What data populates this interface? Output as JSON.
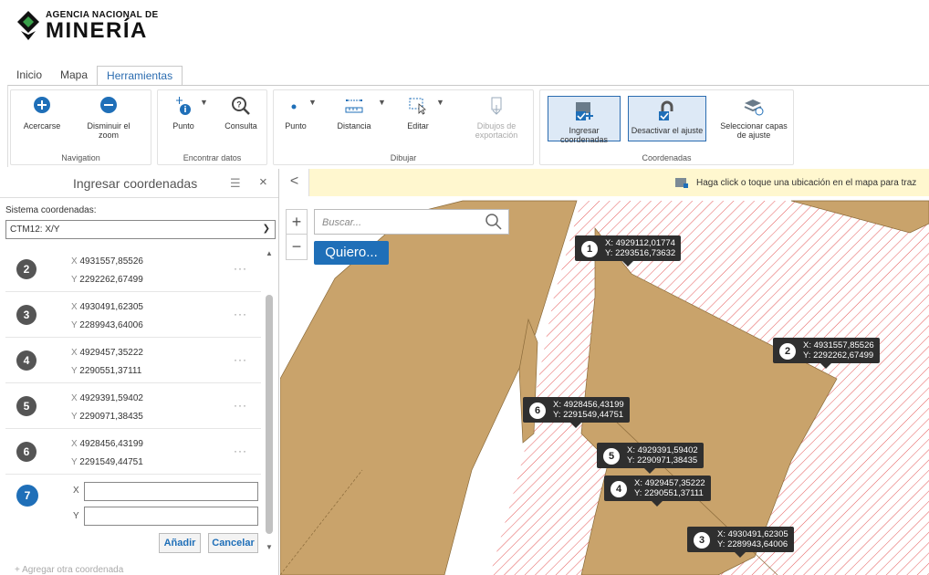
{
  "header": {
    "logo_line1": "AGENCIA NACIONAL DE",
    "logo_line2": "MINERÍA"
  },
  "tabs": [
    {
      "label": "Inicio",
      "active": false
    },
    {
      "label": "Mapa",
      "active": false
    },
    {
      "label": "Herramientas",
      "active": true
    }
  ],
  "ribbon": {
    "navigation": {
      "label": "Navigation",
      "zoom_in": "Acercarse",
      "zoom_out": "Disminuir el zoom"
    },
    "find_data": {
      "label": "Encontrar datos",
      "point": "Punto",
      "query": "Consulta"
    },
    "draw": {
      "label": "Dibujar",
      "point": "Punto",
      "distance": "Distancia",
      "edit": "Editar",
      "export": "Dibujos de exportación"
    },
    "coords": {
      "label": "Coordenadas",
      "enter": "Ingresar coordenadas",
      "disable_snap": "Desactivar el ajuste",
      "select_layers": "Seleccionar capas de ajuste"
    }
  },
  "panel": {
    "title": "Ingresar coordenadas",
    "system_label": "Sistema coordenadas:",
    "system_value": "CTM12: X/Y",
    "rows": [
      {
        "n": "2",
        "x": "4931557,85526",
        "y": "2292262,67499"
      },
      {
        "n": "3",
        "x": "4930491,62305",
        "y": "2289943,64006"
      },
      {
        "n": "4",
        "x": "4929457,35222",
        "y": "2290551,37111"
      },
      {
        "n": "5",
        "x": "4929391,59402",
        "y": "2290971,38435"
      },
      {
        "n": "6",
        "x": "4928456,43199",
        "y": "2291549,44751"
      }
    ],
    "axis_x": "X",
    "axis_y": "Y",
    "more": "···",
    "new_number": "7",
    "new_x": "",
    "new_y": "",
    "add_button": "Añadir",
    "cancel_button": "Cancelar",
    "add_other": "Agregar otra coordenada"
  },
  "map": {
    "hint": "Haga click o toque una ubicación en el mapa para traz",
    "search_placeholder": "Buscar...",
    "quiero": "Quiero...",
    "callouts": [
      {
        "n": "1",
        "x": "X: 4929112,01774",
        "y": "Y: 2293516,73632"
      },
      {
        "n": "2",
        "x": "X: 4931557,85526",
        "y": "Y: 2292262,67499"
      },
      {
        "n": "6",
        "x": "X: 4928456,43199",
        "y": "Y: 2291549,44751"
      },
      {
        "n": "5",
        "x": "X: 4929391,59402",
        "y": "Y: 2290971,38435"
      },
      {
        "n": "4",
        "x": "X: 4929457,35222",
        "y": "Y: 2290551,37111"
      },
      {
        "n": "3",
        "x": "X: 4930491,62305",
        "y": "Y: 2289943,64006"
      }
    ]
  },
  "colors": {
    "accent": "#1f6fb8",
    "parcel": "#c9a36b",
    "hatch": "#e55a5a"
  }
}
